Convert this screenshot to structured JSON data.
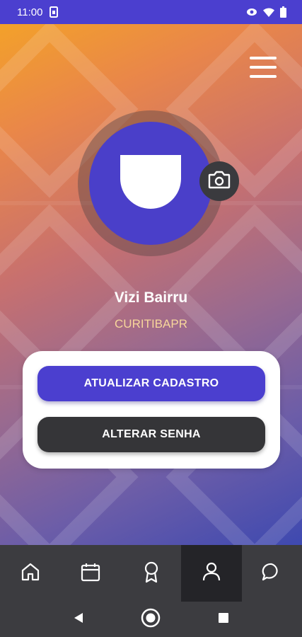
{
  "status_bar": {
    "time": "11:00",
    "icons": [
      "sim-card-icon",
      "eye-icon",
      "wifi-icon",
      "battery-icon"
    ]
  },
  "colors": {
    "primary": "#4b3fcf",
    "dark": "#353538",
    "location_text": "#f7d69b",
    "nav_bg": "#3c3c40"
  },
  "header": {
    "menu_icon": "hamburger-menu-icon"
  },
  "profile": {
    "avatar_icon": "user-placeholder-icon",
    "camera_icon": "camera-icon",
    "name": "Vizi Bairru",
    "location": "CURITIBAPR"
  },
  "actions": {
    "update_label": "ATUALIZAR CADASTRO",
    "password_label": "ALTERAR SENHA"
  },
  "bottom_nav": {
    "items": [
      {
        "icon": "home-icon",
        "active": false
      },
      {
        "icon": "calendar-icon",
        "active": false
      },
      {
        "icon": "badge-icon",
        "active": false
      },
      {
        "icon": "profile-icon",
        "active": true
      },
      {
        "icon": "chat-icon",
        "active": false
      }
    ]
  },
  "system_nav": {
    "items": [
      "back-icon",
      "home-circle-icon",
      "recents-icon"
    ]
  }
}
